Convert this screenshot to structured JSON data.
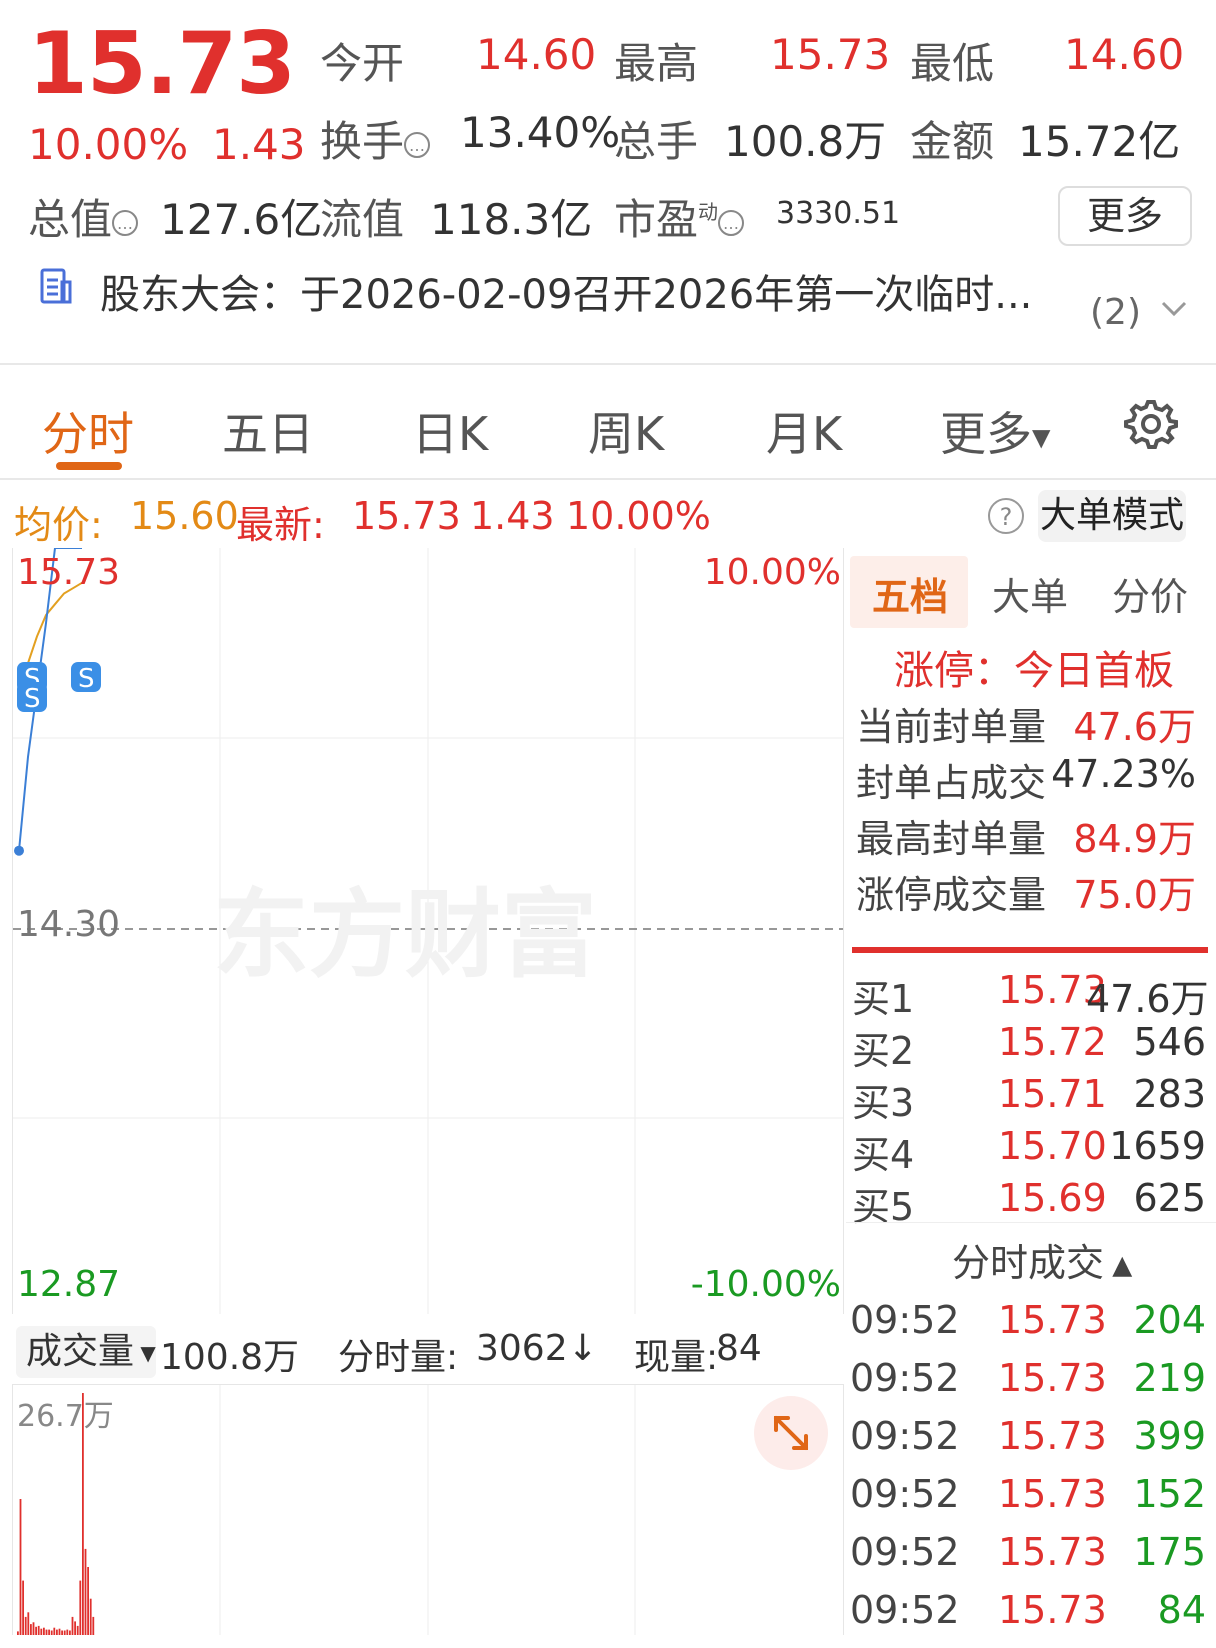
{
  "quote": {
    "price": "15.73",
    "change_pct": "10.00%",
    "change": "1.43",
    "open_label": "今开",
    "open": "14.60",
    "high_label": "最高",
    "high": "15.73",
    "low_label": "最低",
    "low": "14.60",
    "turnover_label": "换手",
    "turnover": "13.40%",
    "volume_label": "总手",
    "volume": "100.8万",
    "amount_label": "金额",
    "amount": "15.72亿",
    "mktcap_label": "总值",
    "mktcap": "127.6亿",
    "float_label": "流值",
    "float": "118.3亿",
    "pe_label": "市盈",
    "pe_sup": "动",
    "pe": "3330.51",
    "more_button": "更多"
  },
  "notice": {
    "text": "股东大会：于2026-02-09召开2026年第一次临时...",
    "count": "(2)"
  },
  "tabs": [
    "分时",
    "五日",
    "日K",
    "周K",
    "月K",
    "更多"
  ],
  "infoline": {
    "avg_label": "均价:",
    "avg": "15.60",
    "latest_label": "最新:",
    "latest": "15.73",
    "change": "1.43",
    "change_pct": "10.00%",
    "help": "?",
    "big_order_mode": "大单模式"
  },
  "chart_axes": {
    "top_price": "15.73",
    "top_pct": "10.00%",
    "mid_price": "14.30",
    "bottom_price": "12.87",
    "bottom_pct": "-10.00%",
    "watermark": "东方财富",
    "marker": "S"
  },
  "chart_data": {
    "type": "line",
    "prev_close": 14.3,
    "ylim": [
      12.87,
      15.73
    ],
    "price_series": [
      14.6,
      14.95,
      15.2,
      15.45,
      15.73,
      15.73,
      15.73,
      15.73
    ],
    "avg_series": [
      15.15,
      15.3,
      15.4,
      15.48,
      15.52,
      15.56,
      15.58,
      15.6
    ],
    "volume_max_label": "26.7万",
    "volume_max": 267000,
    "volumes": [
      4000,
      150000,
      60000,
      20000,
      25000,
      12000,
      14000,
      9000,
      10000,
      7000,
      8000,
      6000,
      6000,
      5000,
      8000,
      6000,
      7000,
      5000,
      5000,
      6000,
      5000,
      20000,
      15000,
      10000,
      60000,
      267000,
      95000,
      75000,
      40000,
      20000
    ]
  },
  "volume_bar": {
    "selector": "成交量",
    "total": "100.8万",
    "minute_label": "分时量:",
    "minute": "3062↓",
    "now_label": "现量:",
    "now": "84"
  },
  "panel_tabs": [
    "五档",
    "大单",
    "分价"
  ],
  "limit_info": {
    "title": "涨停：今日首板",
    "rows": [
      {
        "label": "当前封单量",
        "value": "47.6万"
      },
      {
        "label": "封单占成交",
        "value": "47.23%"
      },
      {
        "label": "最高封单量",
        "value": "84.9万"
      },
      {
        "label": "涨停成交量",
        "value": "75.0万"
      }
    ]
  },
  "orderbook": [
    {
      "label": "买1",
      "price": "15.73",
      "vol": "47.6万"
    },
    {
      "label": "买2",
      "price": "15.72",
      "vol": "546"
    },
    {
      "label": "买3",
      "price": "15.71",
      "vol": "283"
    },
    {
      "label": "买4",
      "price": "15.70",
      "vol": "1659"
    },
    {
      "label": "买5",
      "price": "15.69",
      "vol": "625"
    }
  ],
  "ticks_title": "分时成交",
  "ticks": [
    {
      "time": "09:52",
      "price": "15.73",
      "vol": "204"
    },
    {
      "time": "09:52",
      "price": "15.73",
      "vol": "219"
    },
    {
      "time": "09:52",
      "price": "15.73",
      "vol": "399"
    },
    {
      "time": "09:52",
      "price": "15.73",
      "vol": "152"
    },
    {
      "time": "09:52",
      "price": "15.73",
      "vol": "175"
    },
    {
      "time": "09:52",
      "price": "15.73",
      "vol": "84"
    }
  ],
  "colors": {
    "up": "#e0302d",
    "down": "#1a9a22",
    "accent": "#e06616",
    "avg": "#e3a020",
    "price": "#3b7fd6"
  }
}
